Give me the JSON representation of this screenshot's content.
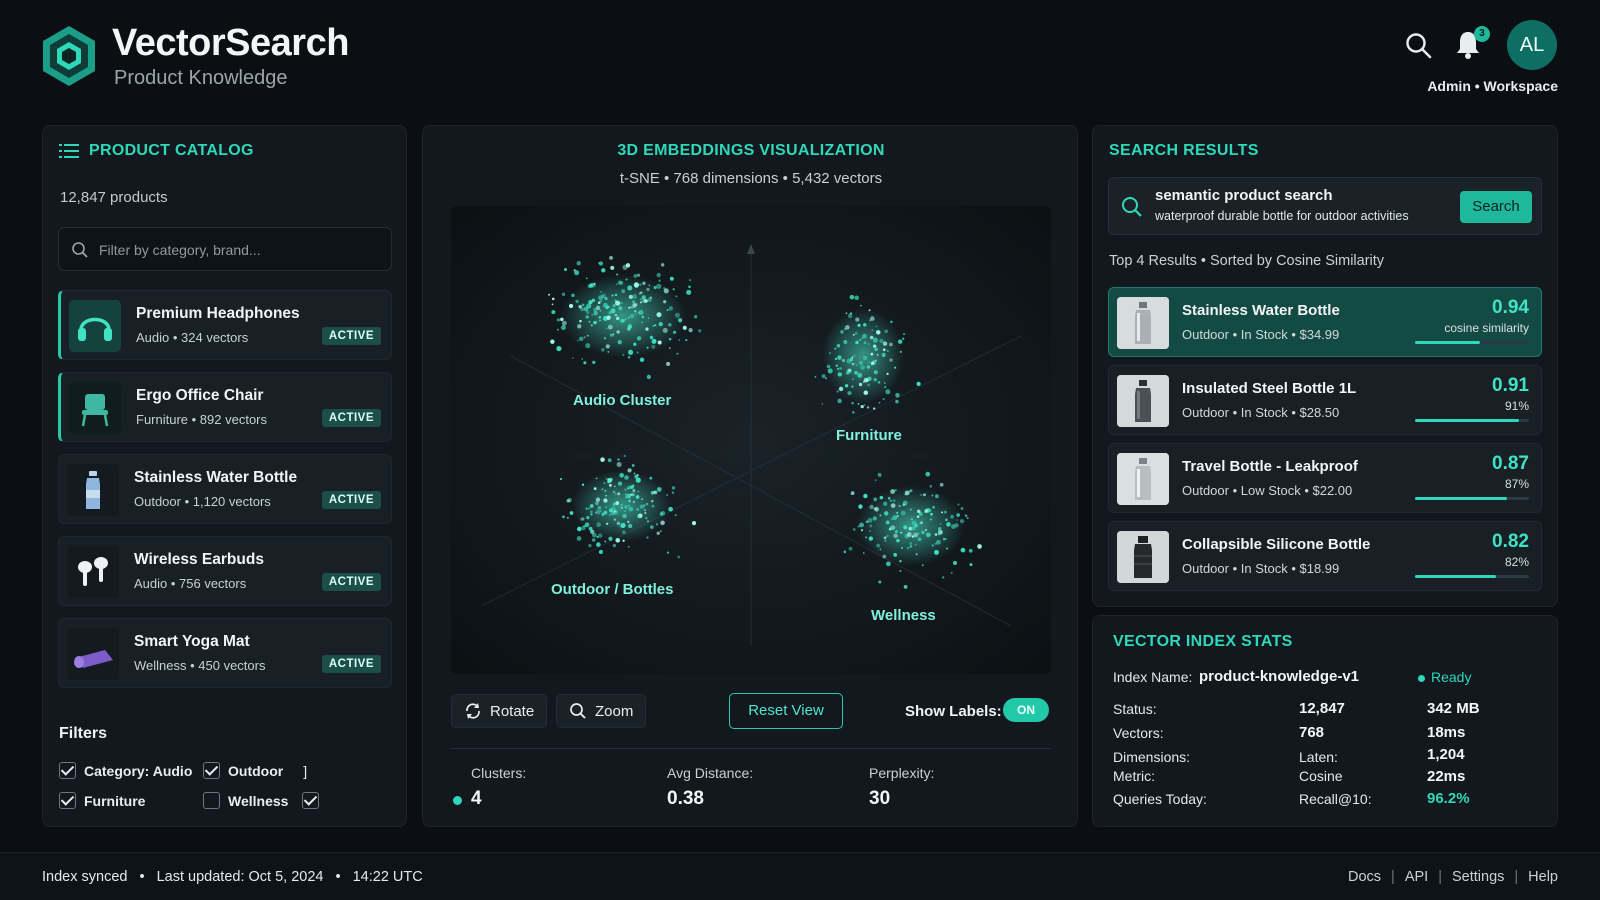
{
  "app": {
    "title": "VectorSearch",
    "subtitle": "Product Knowledge",
    "notifications": "3",
    "avatar_initials": "AL",
    "user_label": "Admin • Workspace"
  },
  "catalog": {
    "title": "PRODUCT CATALOG",
    "count": "12,847 products",
    "filter_placeholder": "Filter by category, brand...",
    "items": [
      {
        "name": "Premium Headphones",
        "meta": "Audio • 324 vectors",
        "badge": "ACTIVE",
        "icon": "headphones-icon"
      },
      {
        "name": "Ergo Office Chair",
        "meta": "Furniture • 892 vectors",
        "badge": "ACTIVE",
        "icon": "chair-icon"
      },
      {
        "name": "Stainless Water Bottle",
        "meta": "Outdoor • 1,120 vectors",
        "badge": "ACTIVE",
        "icon": "bottle-icon"
      },
      {
        "name": "Wireless Earbuds",
        "meta": "Audio • 756 vectors",
        "badge": "ACTIVE",
        "icon": "earbuds-icon"
      },
      {
        "name": "Smart Yoga Mat",
        "meta": "Wellness • 450 vectors",
        "badge": "ACTIVE",
        "icon": "yoga-mat-icon"
      }
    ],
    "filters_title": "Filters",
    "filters": {
      "category_audio": "Category:  Audio",
      "outdoor": "Outdoor",
      "bracket": "]",
      "furniture": "Furniture",
      "wellness": "Wellness"
    }
  },
  "viz": {
    "title": "3D EMBEDDINGS VISUALIZATION",
    "subtitle": "t-SNE • 768 dimensions • 5,432 vectors",
    "clusters": [
      {
        "label": "Audio Cluster"
      },
      {
        "label": "Furniture"
      },
      {
        "label": "Outdoor / Bottles"
      },
      {
        "label": "Wellness"
      }
    ],
    "rotate": "Rotate",
    "zoom": "Zoom",
    "reset": "Reset View",
    "show_labels": "Show Labels:",
    "toggle": "ON",
    "stats": {
      "clusters_label": "Clusters:",
      "clusters_value": "4",
      "distance_label": "Avg Distance:",
      "distance_value": "0.38",
      "perplexity_label": "Perplexity:",
      "perplexity_value": "30"
    }
  },
  "results": {
    "title": "SEARCH RESULTS",
    "query_title": "semantic product search",
    "query_value": "waterproof durable bottle for outdoor activities",
    "search_button": "Search",
    "summary": "Top 4 Results • Sorted by Cosine Similarity",
    "items": [
      {
        "name": "Stainless Water Bottle",
        "meta": "Outdoor • In Stock • $34.99",
        "score": "0.94",
        "score_label": "cosine similarity",
        "fill": 0.57
      },
      {
        "name": "Insulated Steel Bottle 1L",
        "meta": "Outdoor • In Stock • $28.50",
        "score": "0.91",
        "score_label": "91%",
        "fill": 0.91
      },
      {
        "name": "Travel Bottle - Leakproof",
        "meta": "Outdoor • Low Stock • $22.00",
        "score": "0.87",
        "score_label": "87%",
        "fill": 0.81
      },
      {
        "name": "Collapsible Silicone Bottle",
        "meta": "Outdoor • In Stock • $18.99",
        "score": "0.82",
        "score_label": "82%",
        "fill": 0.71
      }
    ]
  },
  "index": {
    "title": "VECTOR INDEX STATS",
    "name_label": "Index Name:",
    "name_value": "product-knowledge-v1",
    "ready": "Ready",
    "labels_col": [
      "Status:",
      "Vectors:",
      "Dimensions:",
      "Metric:",
      "Queries Today:"
    ],
    "mid_col": [
      "12,847",
      "768",
      "Laten:",
      "Cosine",
      "Recall@10:"
    ],
    "right_col": [
      "342 MB",
      "18ms",
      "1,204",
      "22ms",
      "96.2%"
    ]
  },
  "footer": {
    "synced": "Index synced",
    "updated": "Last updated: Oct 5, 2024",
    "time": "14:22 UTC",
    "links": [
      "Docs",
      "API",
      "Settings",
      "Help"
    ]
  },
  "colors": {
    "accent": "#2fd8b8",
    "background": "#0b0f13",
    "panel": "#12181d",
    "selected_result": "#134a44"
  }
}
